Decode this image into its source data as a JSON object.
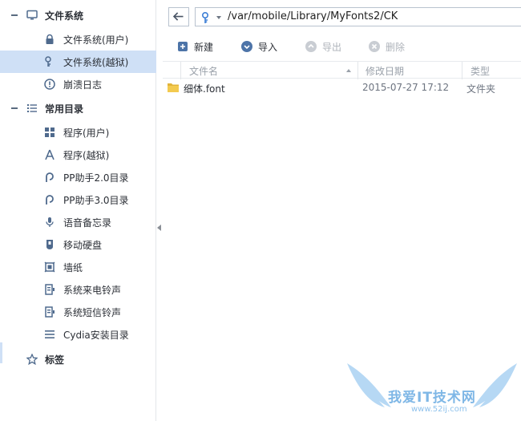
{
  "sidebar": {
    "sections": [
      {
        "label": "文件系统",
        "icon": "monitor-icon"
      },
      {
        "label": "常用目录",
        "icon": "list-icon"
      },
      {
        "label": "标签",
        "icon": "star-icon"
      }
    ],
    "items": [
      {
        "label": "文件系统(用户)",
        "icon": "lock-icon"
      },
      {
        "label": "文件系统(越狱)",
        "icon": "key-icon",
        "selected": true
      },
      {
        "label": "崩溃日志",
        "icon": "alert-icon"
      },
      {
        "label": "程序(用户)",
        "icon": "apps-grid-icon"
      },
      {
        "label": "程序(越狱)",
        "icon": "appstore-icon"
      },
      {
        "label": "PP助手2.0目录",
        "icon": "pp-icon"
      },
      {
        "label": "PP助手3.0目录",
        "icon": "pp-icon"
      },
      {
        "label": "语音备忘录",
        "icon": "microphone-icon"
      },
      {
        "label": "移动硬盘",
        "icon": "drive-icon"
      },
      {
        "label": "墙纸",
        "icon": "wallpaper-icon"
      },
      {
        "label": "系统来电铃声",
        "icon": "ringtone-icon"
      },
      {
        "label": "系统短信铃声",
        "icon": "sms-tone-icon"
      },
      {
        "label": "Cydia安装目录",
        "icon": "menu-lines-icon"
      }
    ]
  },
  "address": {
    "path": "/var/mobile/Library/MyFonts2/CK"
  },
  "toolbar": {
    "new_label": "新建",
    "import_label": "导入",
    "export_label": "导出",
    "delete_label": "删除"
  },
  "columns": {
    "name": "文件名",
    "date": "修改日期",
    "type": "类型"
  },
  "files": [
    {
      "name": "细体.font",
      "date": "2015-07-27 17:12",
      "type": "文件夹",
      "icon": "folder-icon"
    }
  ],
  "watermark": {
    "text": "我爱IT技术网",
    "url": "www.52ij.com"
  },
  "colors": {
    "selected_bg": "#cfe0f6",
    "accent": "#3d7fd6",
    "disabled": "#aeb3ba"
  }
}
